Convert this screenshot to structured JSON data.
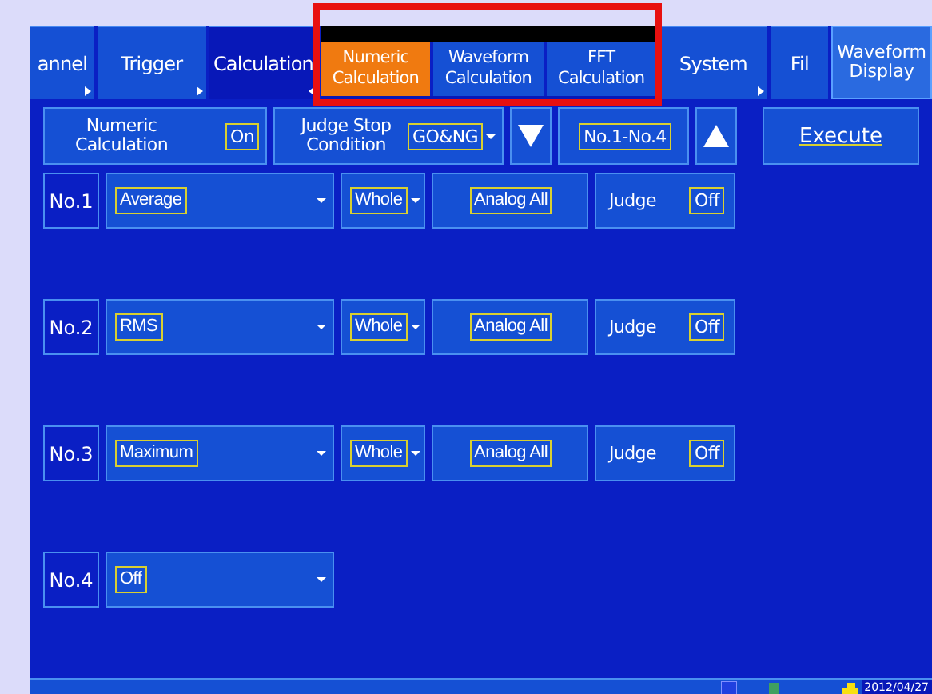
{
  "tabs": [
    {
      "label": "annel",
      "selected": false,
      "arrow": true
    },
    {
      "label": "Trigger",
      "selected": false,
      "arrow": true
    },
    {
      "label": "Calculation",
      "selected": true,
      "arrow": true
    }
  ],
  "sub_tabs": [
    {
      "label": "Numeric Calculation",
      "selected": true
    },
    {
      "label": "Waveform Calculation",
      "selected": false
    },
    {
      "label": "FFT Calculation",
      "selected": false
    }
  ],
  "tabs_right": [
    {
      "label": "System",
      "selected": false,
      "arrow": true
    },
    {
      "label": "Fil",
      "selected": false,
      "arrow": false
    }
  ],
  "waveform_display": "Waveform Display",
  "controls": {
    "numeric_calculation": {
      "label": "Numeric Calculation",
      "value": "On"
    },
    "judge_stop": {
      "label": "Judge Stop Condition",
      "value": "GO&NG"
    },
    "range": "No.1-No.4",
    "execute": "Execute"
  },
  "rows": [
    {
      "number": "No.1",
      "function": "Average",
      "range": "Whole",
      "channel": "Analog All",
      "judge_label": "Judge",
      "judge": "Off"
    },
    {
      "number": "No.2",
      "function": "RMS",
      "range": "Whole",
      "channel": "Analog All",
      "judge_label": "Judge",
      "judge": "Off"
    },
    {
      "number": "No.3",
      "function": "Maximum",
      "range": "Whole",
      "channel": "Analog All",
      "judge_label": "Judge",
      "judge": "Off"
    },
    {
      "number": "No.4",
      "function": "Off"
    }
  ],
  "status_bar": {
    "date": "2012/04/27"
  }
}
